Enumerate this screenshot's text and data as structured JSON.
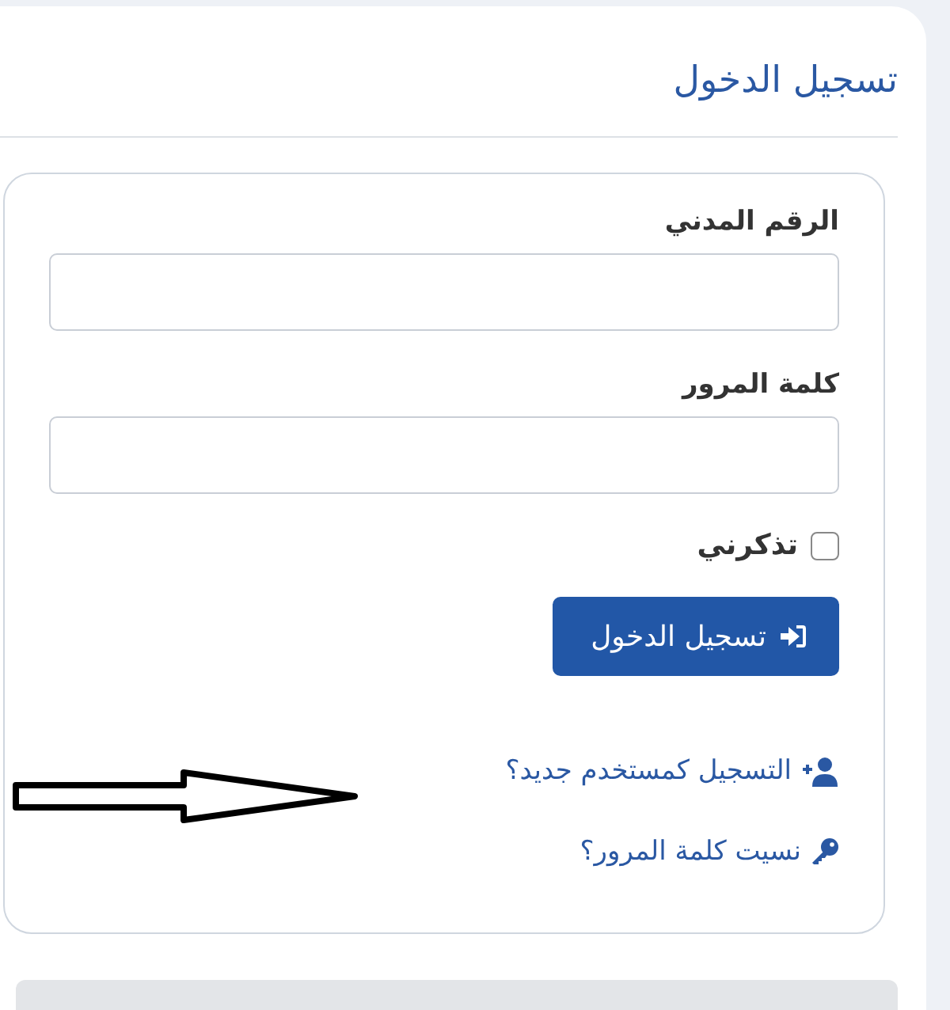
{
  "header": {
    "title": "تسجيل الدخول"
  },
  "form": {
    "fields": [
      {
        "label": "الرقم المدني"
      },
      {
        "label": "كلمة المرور"
      }
    ],
    "remember": {
      "label": "تذكرني",
      "checked": false
    },
    "submit": {
      "label": "تسجيل الدخول"
    },
    "links": [
      {
        "kind": "register",
        "label": "التسجيل كمستخدم جديد؟"
      },
      {
        "kind": "forgot",
        "label": "نسيت كلمة المرور؟"
      }
    ]
  }
}
